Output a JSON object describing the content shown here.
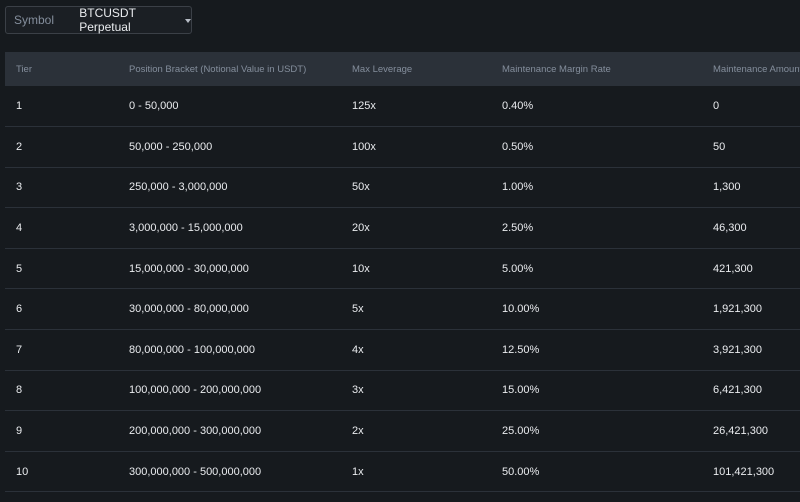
{
  "symbol": {
    "label": "Symbol",
    "value": "BTCUSDT Perpetual"
  },
  "table": {
    "headers": [
      "Tier",
      "Position Bracket (Notional Value in USDT)",
      "Max Leverage",
      "Maintenance Margin Rate",
      "Maintenance Amount"
    ],
    "rows": [
      [
        "1",
        "0 - 50,000",
        "125x",
        "0.40%",
        "0"
      ],
      [
        "2",
        "50,000 - 250,000",
        "100x",
        "0.50%",
        "50"
      ],
      [
        "3",
        "250,000 - 3,000,000",
        "50x",
        "1.00%",
        "1,300"
      ],
      [
        "4",
        "3,000,000 - 15,000,000",
        "20x",
        "2.50%",
        "46,300"
      ],
      [
        "5",
        "15,000,000 - 30,000,000",
        "10x",
        "5.00%",
        "421,300"
      ],
      [
        "6",
        "30,000,000 - 80,000,000",
        "5x",
        "10.00%",
        "1,921,300"
      ],
      [
        "7",
        "80,000,000 - 100,000,000",
        "4x",
        "12.50%",
        "3,921,300"
      ],
      [
        "8",
        "100,000,000 - 200,000,000",
        "3x",
        "15.00%",
        "6,421,300"
      ],
      [
        "9",
        "200,000,000 - 300,000,000",
        "2x",
        "25.00%",
        "26,421,300"
      ],
      [
        "10",
        "300,000,000 - 500,000,000",
        "1x",
        "50.00%",
        "101,421,300"
      ]
    ]
  }
}
